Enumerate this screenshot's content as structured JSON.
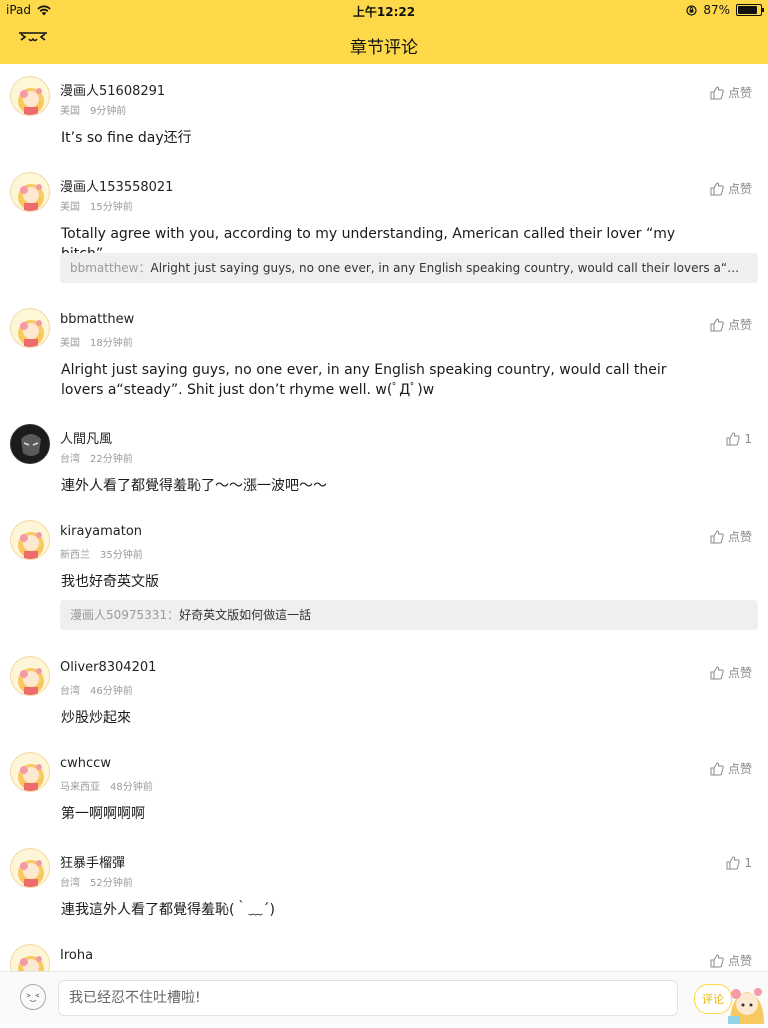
{
  "status": {
    "device": "iPad",
    "time": "上午12:22",
    "battery": "87%",
    "battery_level": 0.87
  },
  "header": {
    "title": "章节评论",
    "face_icon": "emoticon-face-icon"
  },
  "like_label": "点赞",
  "comments": [
    {
      "user": "漫画人51608291",
      "location": "美国",
      "time": "9分钟前",
      "text": "It’s so fine day还行",
      "likes": "点赞"
    },
    {
      "user": "漫画人153558021",
      "location": "美国",
      "time": "15分钟前",
      "text": "Totally agree with you, according to my understanding, American called their lover “my bitch”",
      "likes": "点赞",
      "quote_user": "bbmatthew：",
      "quote_text": "Alright just saying guys, no one ever, in any English speaking country, would call their lovers a“steady”. Shit just don’t rhyme well."
    },
    {
      "user": "bbmatthew",
      "location": "美国",
      "time": "18分钟前",
      "text": "Alright just saying guys, no one ever, in any English speaking country, would call their lovers a“steady”. Shit just don’t rhyme well. w(ﾟДﾟ)w",
      "likes": "点赞"
    },
    {
      "user": "人間凡風",
      "location": "台湾",
      "time": "22分钟前",
      "text": "連外人看了都覺得羞恥了～～漲一波吧～～",
      "likes": "1"
    },
    {
      "user": "kirayamaton",
      "location": "新西兰",
      "time": "35分钟前",
      "text": "我也好奇英文版",
      "likes": "点赞",
      "quote_user": "漫画人50975331：",
      "quote_text": "好奇英文版如何做這一話"
    },
    {
      "user": "Oliver8304201",
      "location": "台湾",
      "time": "46分钟前",
      "text": "炒股炒起來",
      "likes": "点赞"
    },
    {
      "user": "cwhccw",
      "location": "马来西亚",
      "time": "48分钟前",
      "text": "第一啊啊啊啊",
      "likes": "点赞"
    },
    {
      "user": "狂暴手榴彈",
      "location": "台湾",
      "time": "52分钟前",
      "text": "連我這外人看了都覺得羞恥(｀﹏´)",
      "likes": "1"
    },
    {
      "user": "Iroha",
      "likes": "点赞"
    }
  ],
  "bottom_bar": {
    "placeholder": "我已经忍不住吐槽啦!",
    "submit_label": "评论"
  },
  "colors": {
    "accent": "#fdd94a",
    "quote_bg": "#efefef",
    "meta_text": "#9a9a9a"
  }
}
